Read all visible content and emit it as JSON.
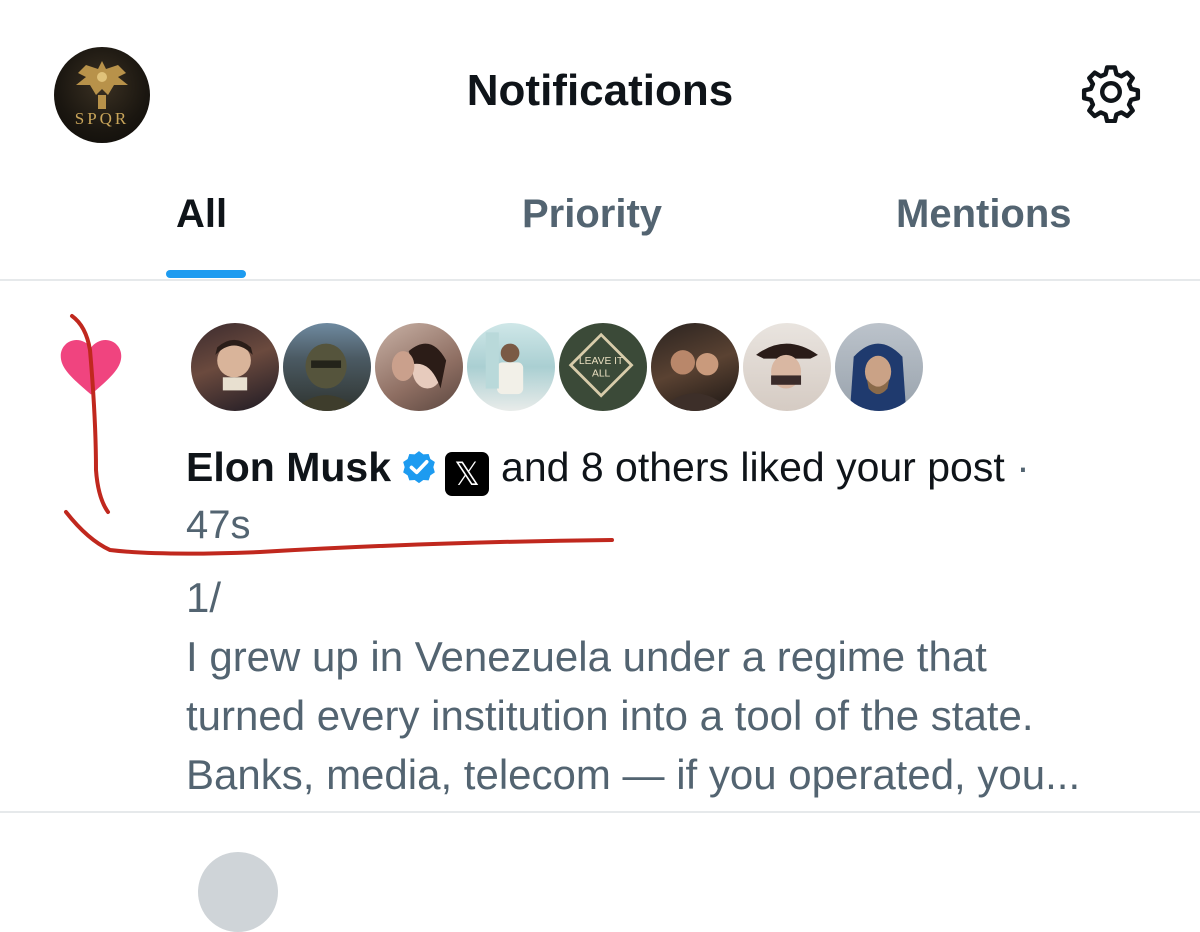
{
  "header": {
    "title": "Notifications",
    "avatar_text": "SPQR"
  },
  "tabs": [
    {
      "label": "All",
      "active": true
    },
    {
      "label": "Priority",
      "active": false
    },
    {
      "label": "Mentions",
      "active": false
    }
  ],
  "notification": {
    "actor_name": "Elon Musk",
    "x_badge": "𝕏",
    "action_text": "and 8 others liked your post",
    "separator": "·",
    "time": "47s",
    "avatar_count": 8,
    "avatar_4_text_1": "LEAVE IT",
    "avatar_4_text_2": "ALL",
    "post_lines": [
      "1/",
      "I grew up in Venezuela under a regime that",
      "turned every institution into a tool of the state.",
      "Banks, media, telecom — if you operated, you..."
    ]
  },
  "colors": {
    "accent": "#1d9bf0",
    "heart": "#f91880",
    "text_primary": "#0f1419",
    "text_secondary": "#536471",
    "annotation": "#c0281e"
  },
  "icons": {
    "settings": "gear-icon",
    "like": "heart-icon",
    "verified": "verified-badge-icon"
  }
}
